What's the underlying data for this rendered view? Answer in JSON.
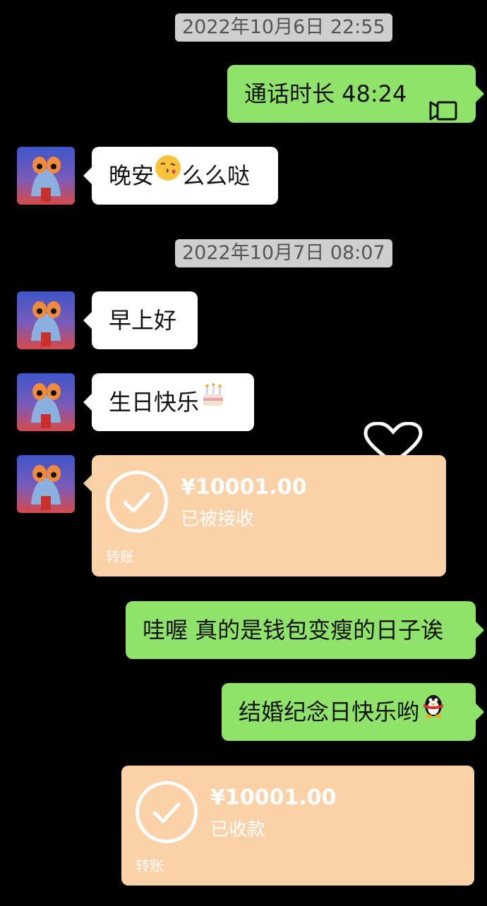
{
  "timestamps": [
    "2022年10月6日 22:55",
    "2022年10月7日 08:07"
  ],
  "messages": {
    "call_duration": "通话时长 48:24",
    "goodnight_a": "晚安",
    "goodnight_b": "么么哒",
    "good_morning": "早上好",
    "birthday": "生日快乐",
    "wow_reply": "哇喔 真的是钱包变瘦的日子诶",
    "anniversary": "结婚纪念日快乐哟"
  },
  "transfers": [
    {
      "amount": "¥10001.00",
      "status": "已被接收",
      "label": "转账"
    },
    {
      "amount": "¥10001.00",
      "status": "已收款",
      "label": "转账"
    }
  ],
  "colors": {
    "background": "#000000",
    "incoming_bubble": "#ffffff",
    "outgoing_bubble": "#8fe36a",
    "transfer_card": "#fbd1a8",
    "timestamp_bg": "#cfcfcf"
  },
  "icons": [
    "video-call-icon",
    "kiss-emoji-icon",
    "birthday-cake-emoji-icon",
    "heart-outline-icon",
    "check-circle-icon",
    "penguin-emoji-icon"
  ]
}
